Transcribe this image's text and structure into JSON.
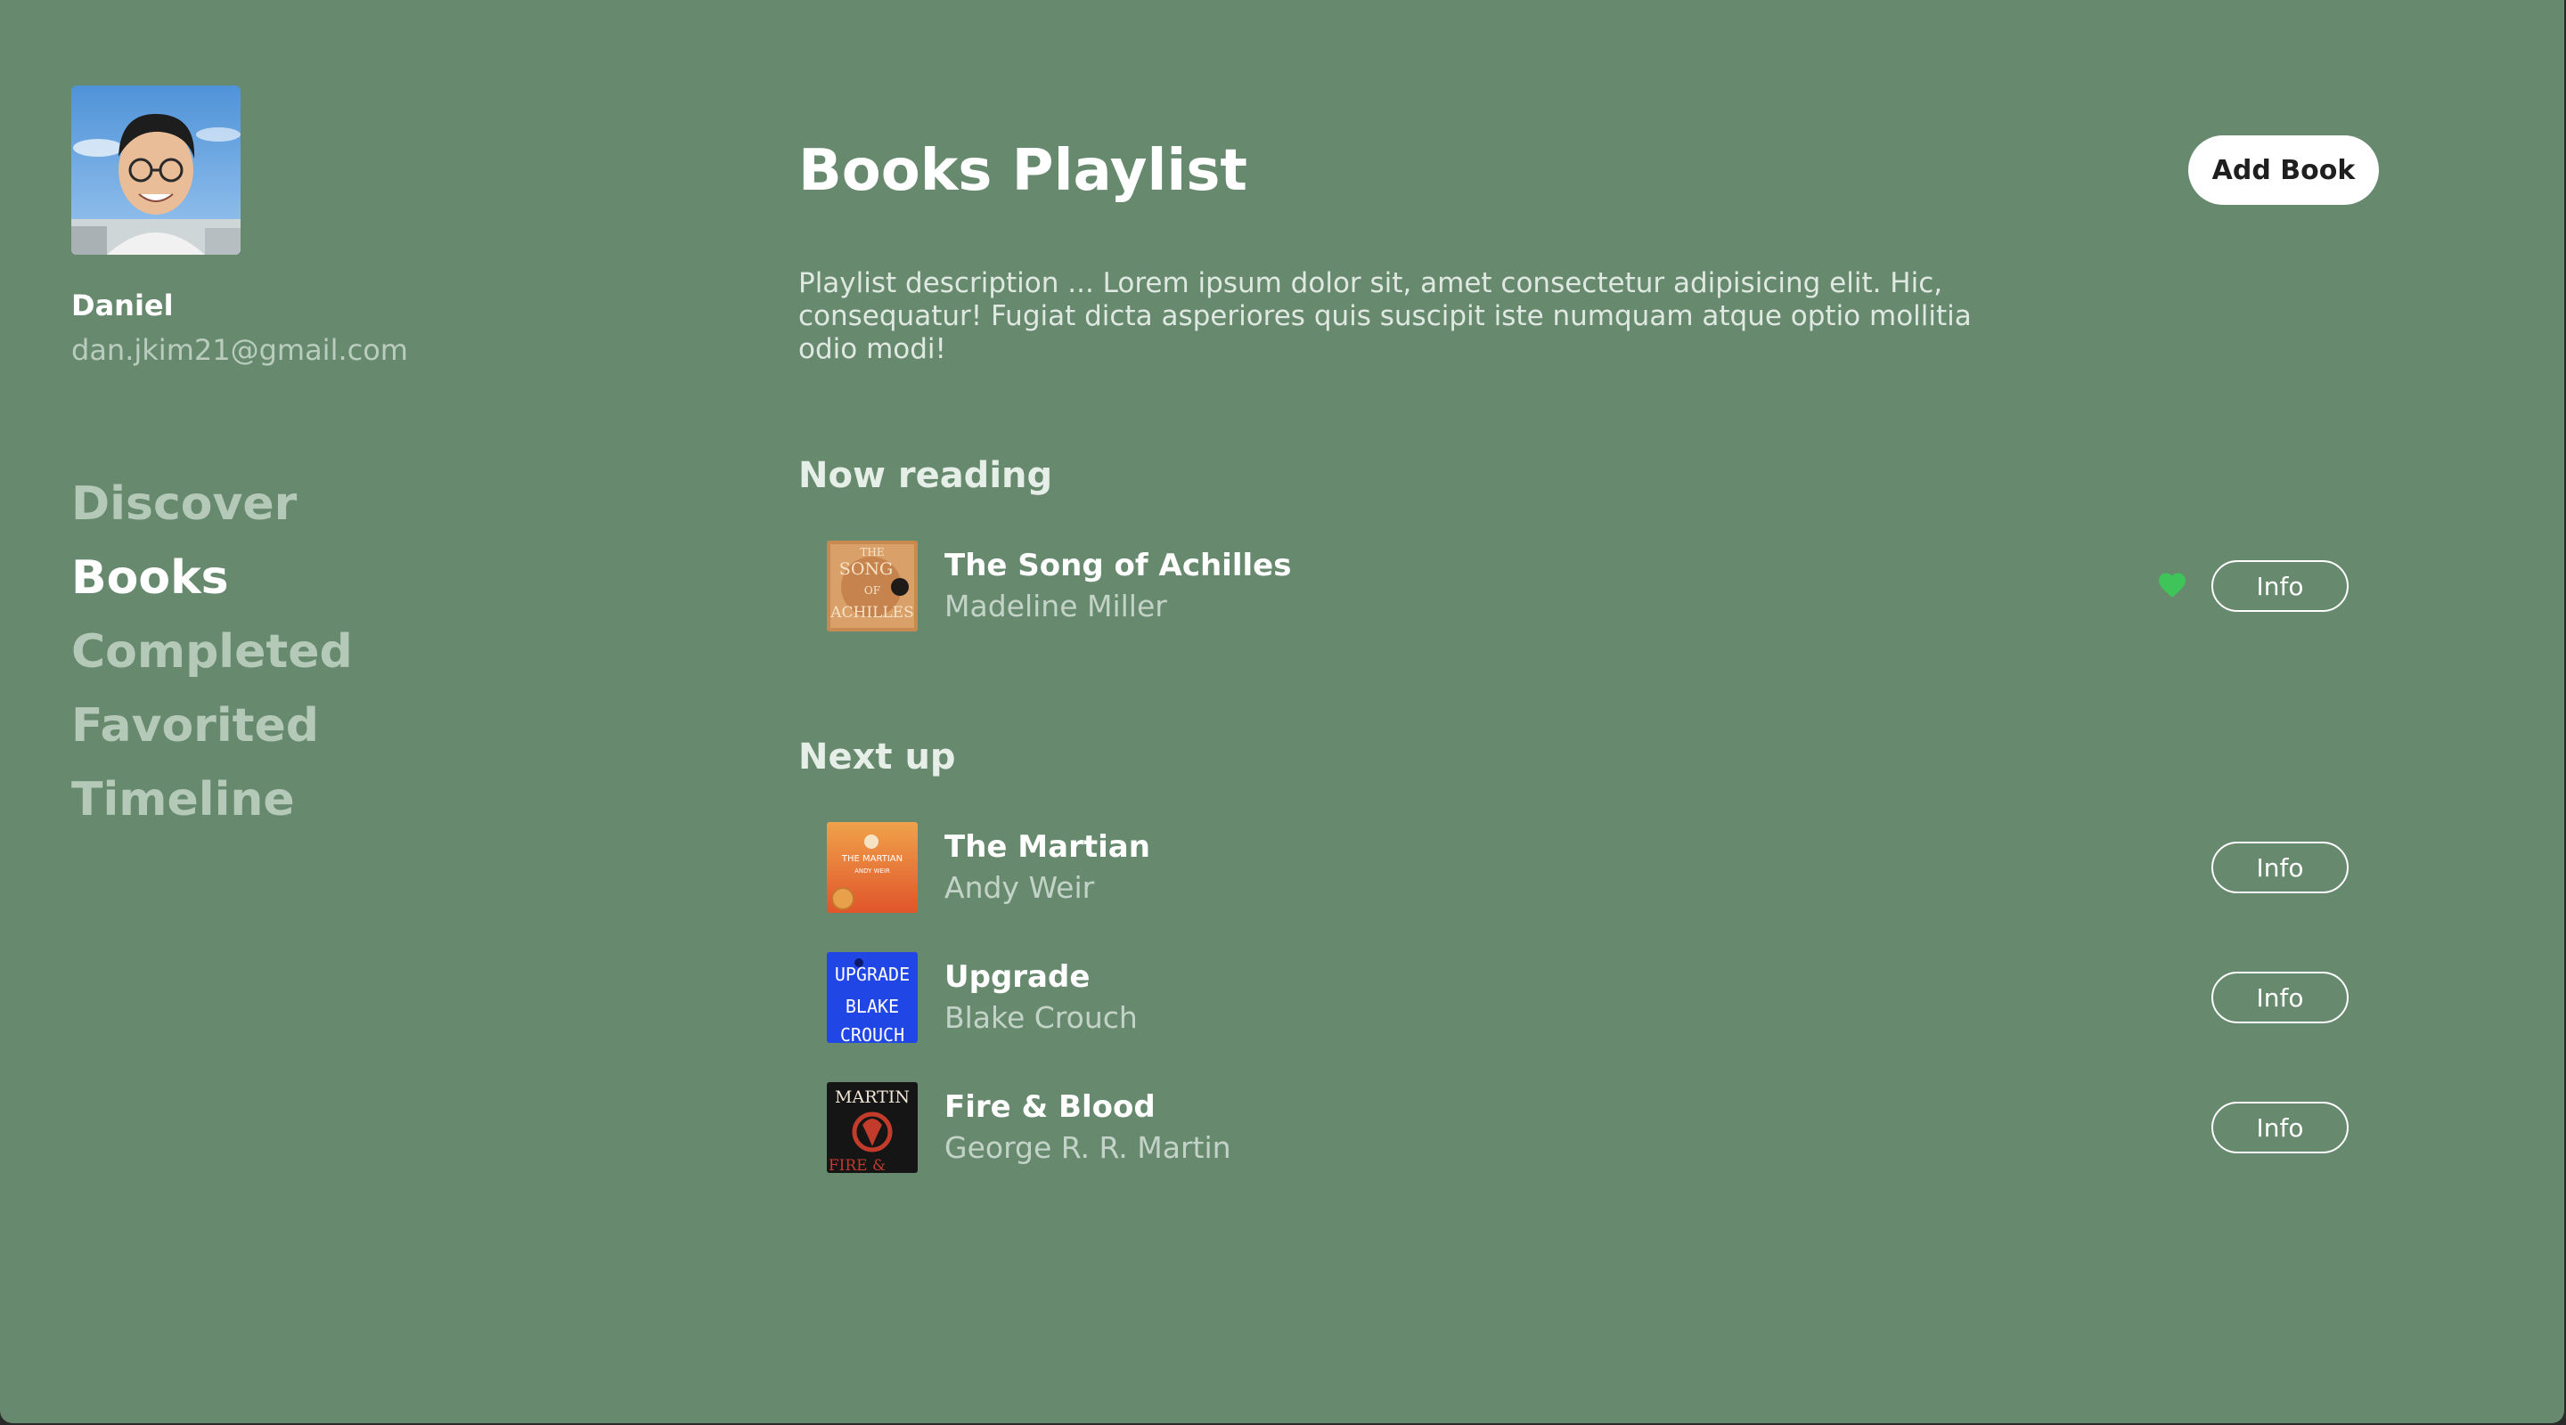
{
  "user": {
    "name": "Daniel",
    "email": "dan.jkim21@gmail.com"
  },
  "nav": {
    "items": [
      {
        "label": "Discover",
        "active": false
      },
      {
        "label": "Books",
        "active": true
      },
      {
        "label": "Completed",
        "active": false
      },
      {
        "label": "Favorited",
        "active": false
      },
      {
        "label": "Timeline",
        "active": false
      }
    ]
  },
  "page": {
    "title": "Books Playlist",
    "add_button": "Add Book",
    "description": "Playlist description ... Lorem ipsum dolor sit, amet consectetur adipisicing elit. Hic, consequatur! Fugiat dicta asperiores quis suscipit iste numquam atque optio mollitia odio modi!"
  },
  "now_reading": {
    "heading": "Now reading",
    "books": [
      {
        "title": "The Song of Achilles",
        "author": "Madeline Miller",
        "favorited": true,
        "info_label": "Info"
      }
    ]
  },
  "next_up": {
    "heading": "Next up",
    "books": [
      {
        "title": "The Martian",
        "author": "Andy Weir",
        "favorited": false,
        "info_label": "Info"
      },
      {
        "title": "Upgrade",
        "author": "Blake Crouch",
        "favorited": false,
        "info_label": "Info"
      },
      {
        "title": "Fire & Blood",
        "author": "George R. R. Martin",
        "favorited": false,
        "info_label": "Info"
      }
    ]
  },
  "covers": {
    "achilles": [
      "THE",
      "SONG",
      "OF",
      "ACHILLES"
    ],
    "martian": [
      "THE MARTIAN",
      "ANDY WEIR"
    ],
    "upgrade": [
      "UPGRADE",
      "BLAKE",
      "CROUCH"
    ],
    "fire_blood": [
      "MARTIN",
      "FIRE &"
    ]
  },
  "colors": {
    "background": "#678a6f",
    "heart": "#3fc45a",
    "muted_text": "#b5c9b9"
  }
}
